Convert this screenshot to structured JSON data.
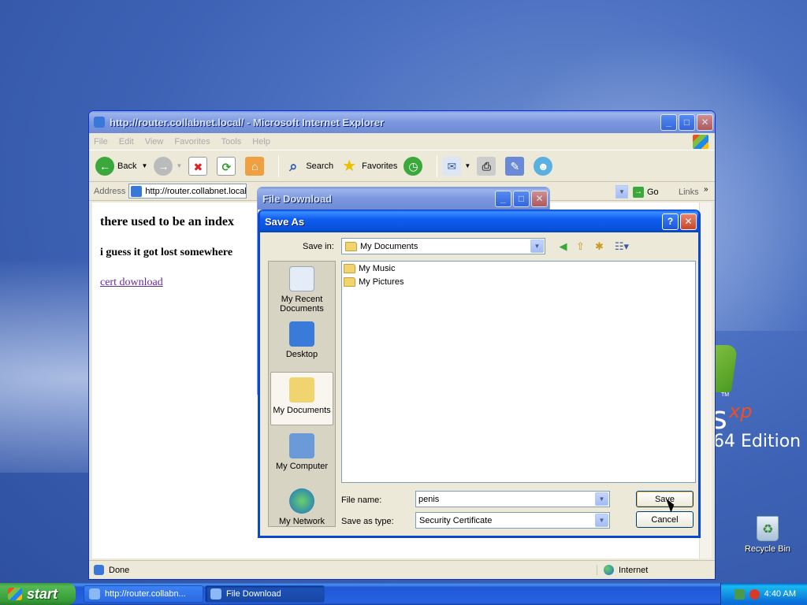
{
  "ie_window": {
    "title": "http://router.collabnet.local/ - Microsoft Internet Explorer",
    "menus": [
      "File",
      "Edit",
      "View",
      "Favorites",
      "Tools",
      "Help"
    ],
    "toolbar": {
      "back": "Back",
      "search": "Search",
      "favorites": "Favorites"
    },
    "address_label": "Address",
    "address_value": "http://router.collabnet.local/",
    "go_label": "Go",
    "links_label": "Links",
    "page": {
      "heading": "there used to be an index",
      "line2": "i guess it got lost somewhere",
      "link": "cert download"
    },
    "status": "Done",
    "zone": "Internet"
  },
  "file_download": {
    "title": "File Download"
  },
  "save_as": {
    "title": "Save As",
    "save_in_label": "Save in:",
    "save_in_value": "My Documents",
    "places": [
      {
        "label": "My Recent Documents",
        "icon": "recent-documents-icon"
      },
      {
        "label": "Desktop",
        "icon": "desktop-icon"
      },
      {
        "label": "My Documents",
        "icon": "my-documents-icon"
      },
      {
        "label": "My Computer",
        "icon": "my-computer-icon"
      },
      {
        "label": "My Network",
        "icon": "my-network-icon"
      }
    ],
    "files": [
      "My Music",
      "My Pictures"
    ],
    "file_name_label": "File name:",
    "file_name_value": "penis",
    "save_as_type_label": "Save as type:",
    "save_as_type_value": "Security Certificate",
    "save_button": "Save",
    "cancel_button": "Cancel"
  },
  "desktop": {
    "recycle_bin": "Recycle Bin",
    "brand_s": "s",
    "brand_xp": "xp",
    "brand_tm": "TM",
    "brand_edition": "64 Edition"
  },
  "taskbar": {
    "start": "start",
    "tasks": [
      "http://router.collabn...",
      "File Download"
    ],
    "clock": "4:40 AM"
  },
  "colors": {
    "xp_blue": "#0a5ae8",
    "start_green": "#54b854",
    "link_visited": "#6a2a9a"
  }
}
